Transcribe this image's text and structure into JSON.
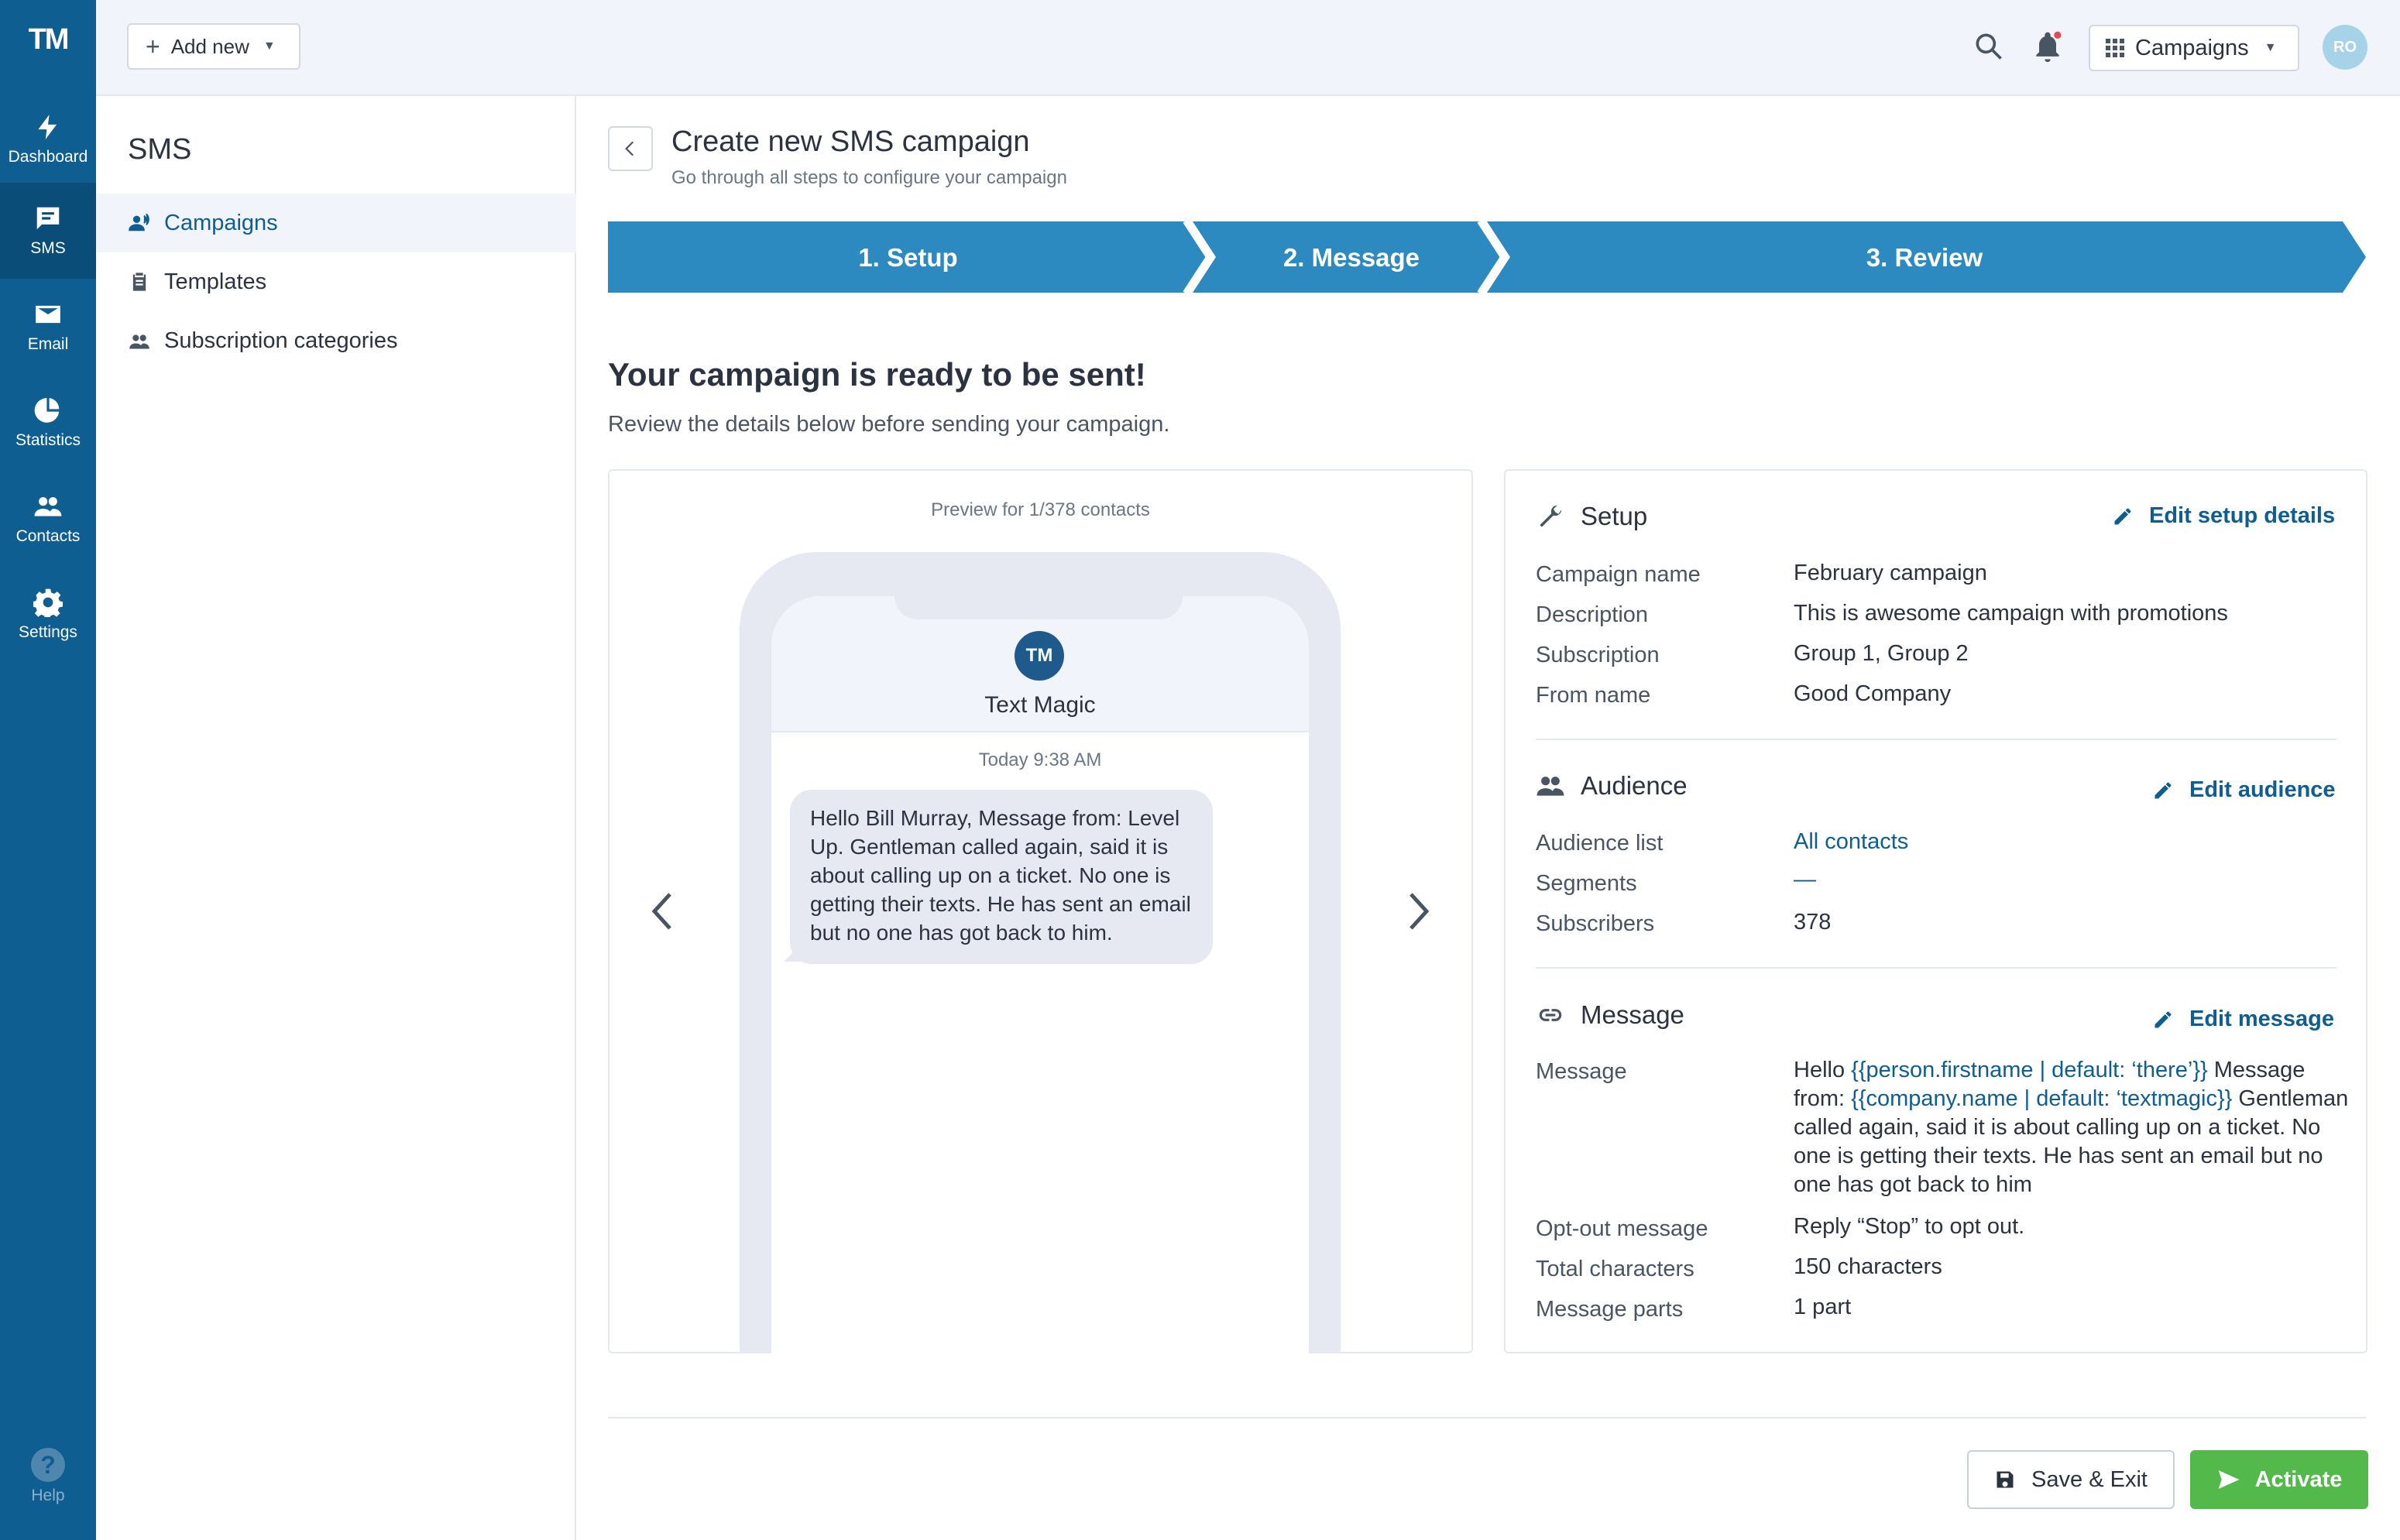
{
  "rail": {
    "logo": "TM",
    "items": [
      {
        "label": "Dashboard",
        "icon": "bolt-icon"
      },
      {
        "label": "SMS",
        "icon": "chat-icon"
      },
      {
        "label": "Email",
        "icon": "mail-icon"
      },
      {
        "label": "Statistics",
        "icon": "pie-icon"
      },
      {
        "label": "Contacts",
        "icon": "people-icon"
      },
      {
        "label": "Settings",
        "icon": "gear-icon"
      }
    ],
    "help_label": "Help"
  },
  "topbar": {
    "add_new_label": "Add new",
    "app_switcher_label": "Campaigns",
    "avatar_initials": "RO"
  },
  "sidebar": {
    "title": "SMS",
    "items": [
      {
        "label": "Campaigns"
      },
      {
        "label": "Templates"
      },
      {
        "label": "Subscription categories"
      }
    ]
  },
  "header": {
    "title": "Create new SMS campaign",
    "subtitle": "Go through all steps to configure your campaign"
  },
  "steps": [
    {
      "label": "1. Setup"
    },
    {
      "label": "2. Message"
    },
    {
      "label": "3. Review"
    }
  ],
  "review": {
    "title": "Your campaign is ready to be sent!",
    "subtitle": "Review the details below before sending your campaign."
  },
  "preview": {
    "caption": "Preview for 1/378 contacts",
    "sender_initials": "TM",
    "sender_name": "Text Magic",
    "time": "Today 9:38 AM",
    "message": "Hello Bill Murray, Message from: Level Up. Gentleman called again, said it is about calling up on a ticket. No one is getting their texts. He has sent an email but no one has got back to him."
  },
  "summary": {
    "setup": {
      "title": "Setup",
      "edit_label": "Edit setup details",
      "rows": [
        {
          "label": "Campaign name",
          "value": "February campaign"
        },
        {
          "label": "Description",
          "value": "This is awesome campaign with promotions"
        },
        {
          "label": "Subscription",
          "value": "Group 1, Group 2"
        },
        {
          "label": "From name",
          "value": "Good Company"
        }
      ]
    },
    "audience": {
      "title": "Audience",
      "edit_label": "Edit audience",
      "rows": [
        {
          "label": "Audience list",
          "value": "All contacts"
        },
        {
          "label": "Segments",
          "value": "—"
        },
        {
          "label": "Subscribers",
          "value": "378"
        }
      ]
    },
    "message": {
      "title": "Message",
      "edit_label": "Edit message",
      "message_label": "Message",
      "message_parts": {
        "p1": "Hello ",
        "v1": "{{person.firstname | default: ‘there’}}",
        "p2": " Message from: ",
        "v2": "{{company.name | default: ‘textmagic}}",
        "p3": " Gentleman called again, said it is about calling up on a ticket. No one is getting their texts. He has sent an email but no one has got back to him"
      },
      "rows": [
        {
          "label": "Opt-out message",
          "value": "Reply “Stop” to opt out."
        },
        {
          "label": "Total characters",
          "value": "150 characters"
        },
        {
          "label": "Message parts",
          "value": "1 part"
        }
      ]
    }
  },
  "footer": {
    "save_label": "Save & Exit",
    "activate_label": "Activate"
  },
  "colors": {
    "rail": "#0e5e92",
    "step": "#2d8ac0",
    "accent": "#0e5e92",
    "activate": "#54b94b"
  }
}
